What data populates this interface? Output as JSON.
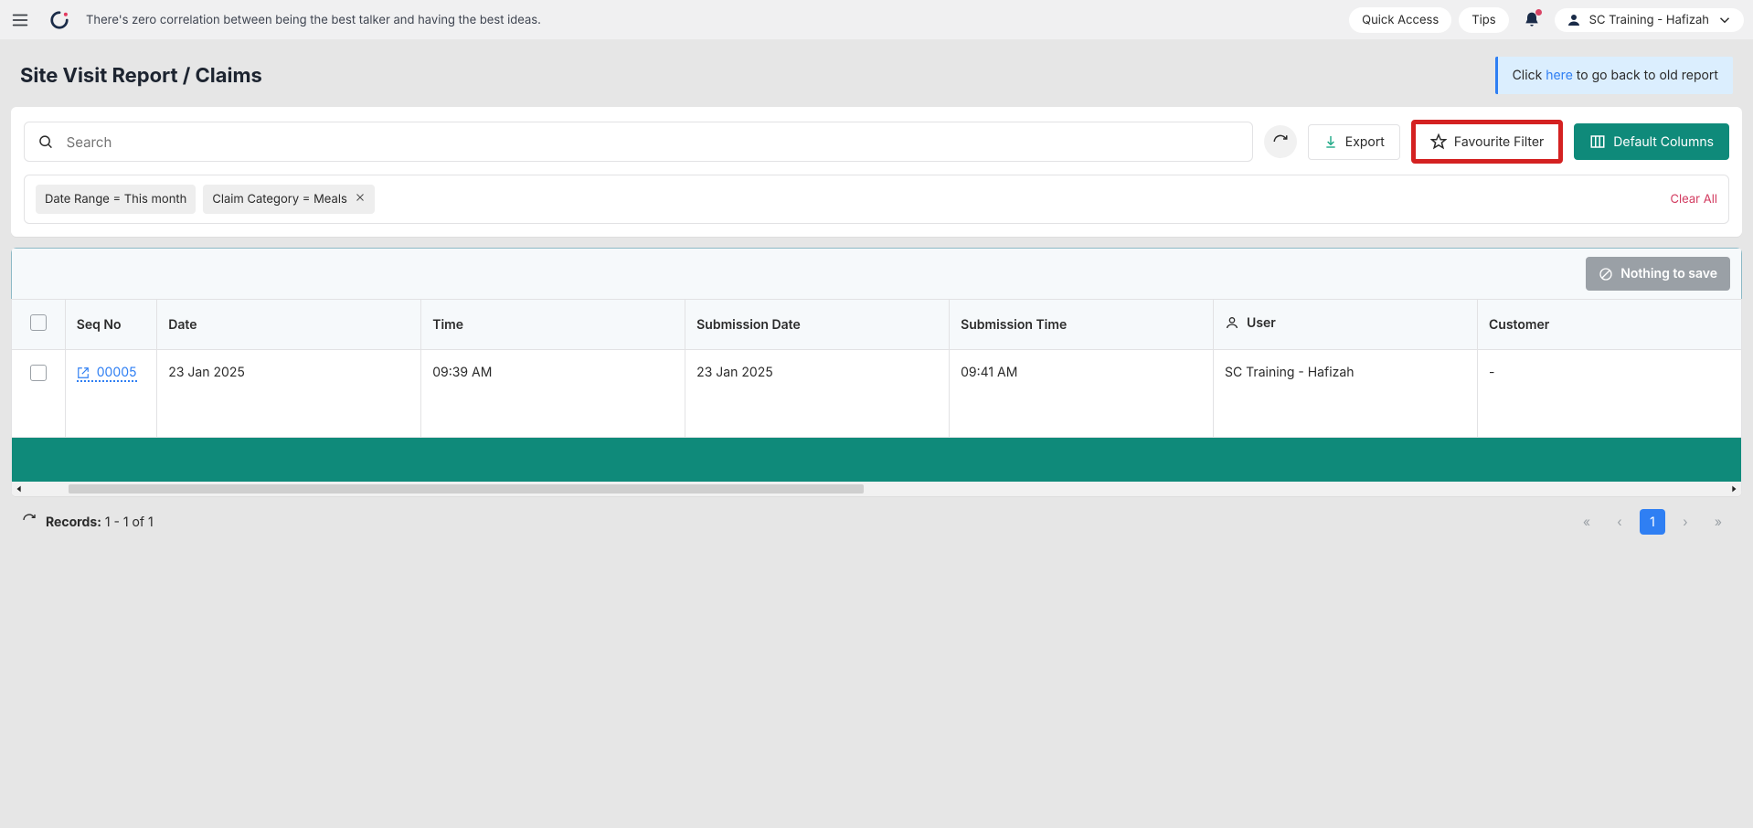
{
  "header": {
    "quote": "There's zero correlation between being the best talker and having the best ideas.",
    "quick_access": "Quick Access",
    "tips": "Tips",
    "user_name": "SC Training - Hafizah"
  },
  "page": {
    "title": "Site Visit Report / Claims",
    "banner_prefix": "Click ",
    "banner_link": "here",
    "banner_suffix": " to go back to old report"
  },
  "toolbar": {
    "search_placeholder": "Search",
    "export_label": "Export",
    "favourite_label": "Favourite Filter",
    "default_columns_label": "Default Columns"
  },
  "filters": {
    "chips": [
      {
        "label": "Date Range  =  This month",
        "removable": false
      },
      {
        "label": "Claim Category  =  Meals",
        "removable": true
      }
    ],
    "clear_all": "Clear All"
  },
  "savebar": {
    "nothing_label": "Nothing to save"
  },
  "table": {
    "columns": [
      "Seq No",
      "Date",
      "Time",
      "Submission Date",
      "Submission Time",
      "User",
      "Customer"
    ],
    "user_icon": true,
    "rows": [
      {
        "seq": "00005",
        "date": "23 Jan 2025",
        "time": "09:39 AM",
        "sub_date": "23 Jan 2025",
        "sub_time": "09:41 AM",
        "user": "SC Training - Hafizah",
        "customer": "-"
      }
    ]
  },
  "footer": {
    "records_prefix": "Records:",
    "records_range": "1 - 1",
    "records_of": "of",
    "records_total": "1",
    "page_current": "1"
  }
}
